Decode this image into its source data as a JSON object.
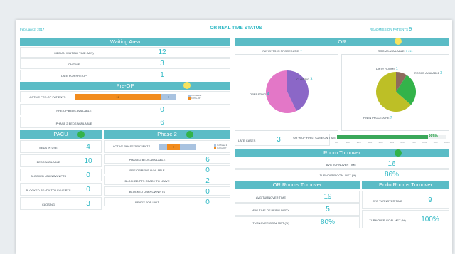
{
  "header": {
    "date": "February 2, 2017",
    "title": "OR REAL TIME STATUS",
    "readmissions_label": "READMISSION PATIENTS",
    "readmissions_value": "9"
  },
  "waiting": {
    "title": "Waiting Area",
    "rows": [
      {
        "label": "MEDIAN WAITING TIME (MIN)",
        "value": "12"
      },
      {
        "label": "ON TIME",
        "value": "3"
      },
      {
        "label": "LATE FOR PRE-OP",
        "value": "1"
      }
    ]
  },
  "preop": {
    "title": "Pre-OP",
    "bar_label": "ACTIVE PRE-OP PATIENTS",
    "bar_value_a": "11",
    "bar_value_b": "2",
    "legend_a": "In Phase 2",
    "legend_b": "In Pre-OP",
    "rows": [
      {
        "label": "PRE-OP BEDS AVAILABLE",
        "value": "0"
      },
      {
        "label": "PHASE 2 BEDS AVAILABLE",
        "value": "6"
      }
    ]
  },
  "or": {
    "title": "OR",
    "pip_label": "PATIENTS IN PROCEDURE",
    "pip_value": "7",
    "rooms_label": "ROOMS AVAILABLE",
    "rooms_value": "3 / 11",
    "pie1": {
      "closing_label": "CLOSING",
      "closing_value": "3",
      "operating_label": "OPERATING",
      "operating_value": "4"
    },
    "pie2": {
      "dirty_label": "DIRTY ROOMS",
      "dirty_value": "1",
      "avail_label": "ROOMS AVAILABLE",
      "avail_value": "3",
      "pip_label": "PTs IN PROCEDURE",
      "pip_value": "7"
    },
    "late_label": "LATE CASES",
    "late_value": "3",
    "fcot_label": "OR % of FIRST CASE ON TIME",
    "fcot_value": "83%",
    "fcot_fraction": 0.83,
    "axis_ticks": [
      "0%",
      "10%",
      "20%",
      "30%",
      "40%",
      "50%",
      "60%",
      "70%",
      "80%",
      "90%",
      "100%"
    ]
  },
  "pacu": {
    "title": "PACU",
    "rows": [
      {
        "label": "BEDS IN USE",
        "value": "4"
      },
      {
        "label": "BEDS AVAILABLE",
        "value": "10"
      },
      {
        "label": "BLOCKED UNKNOWN PTs",
        "value": "0"
      },
      {
        "label": "BLOCKED READY TO LEAVE PTs",
        "value": "0"
      },
      {
        "label": "CLOSING",
        "value": "3"
      }
    ]
  },
  "phase2": {
    "title": "Phase 2",
    "bar_label": "ACTIVE PHASE 2 PATIENTS",
    "bar_value_a": "2",
    "bar_value_b": "",
    "legend_a": "In Phase 2",
    "legend_b": "In Pre-OP",
    "rows": [
      {
        "label": "PHASE 2 BEDS AVAILABLE",
        "value": "6"
      },
      {
        "label": "PRE-OP BEDS AVAILABLE",
        "value": "0"
      },
      {
        "label": "BLOCKED PTs READY TO LEAVE",
        "value": "2"
      },
      {
        "label": "BLOCKED UNKNOWN PTs",
        "value": "0"
      },
      {
        "label": "READY FOR UNIT",
        "value": "0"
      }
    ]
  },
  "room_turnover": {
    "title": "Room Turnover",
    "avg_label": "AVG TURNOVER TIME",
    "avg_value": "16",
    "goal_label": "TURNOVER GOAL MET (%)",
    "goal_value": "86%"
  },
  "or_rooms": {
    "title": "OR Rooms Turnover",
    "rows": [
      {
        "label": "AVG TURNOVER TIME",
        "value": "19"
      },
      {
        "label": "AVG TIME OF BEING DIRTY",
        "value": "5"
      },
      {
        "label": "TURNOVER GOAL MET (%)",
        "value": "80%"
      }
    ]
  },
  "endo_rooms": {
    "title": "Endo Rooms Turnover",
    "rows": [
      {
        "label": "AVG TURNOVER TIME",
        "value": "9"
      },
      {
        "label": "TURNOVER GOAL MET (%)",
        "value": "100%"
      }
    ]
  },
  "colors": {
    "header": "#5bbcc6",
    "value": "#2eb8c4",
    "orange": "#f28c1e",
    "lightblue": "#a9c3e0",
    "green": "#33b34a",
    "yellow": "#f7e35e",
    "purple": "#8b67c7",
    "pink": "#e377c7",
    "olive": "#bdbf26",
    "brown": "#8e6b5d"
  }
}
